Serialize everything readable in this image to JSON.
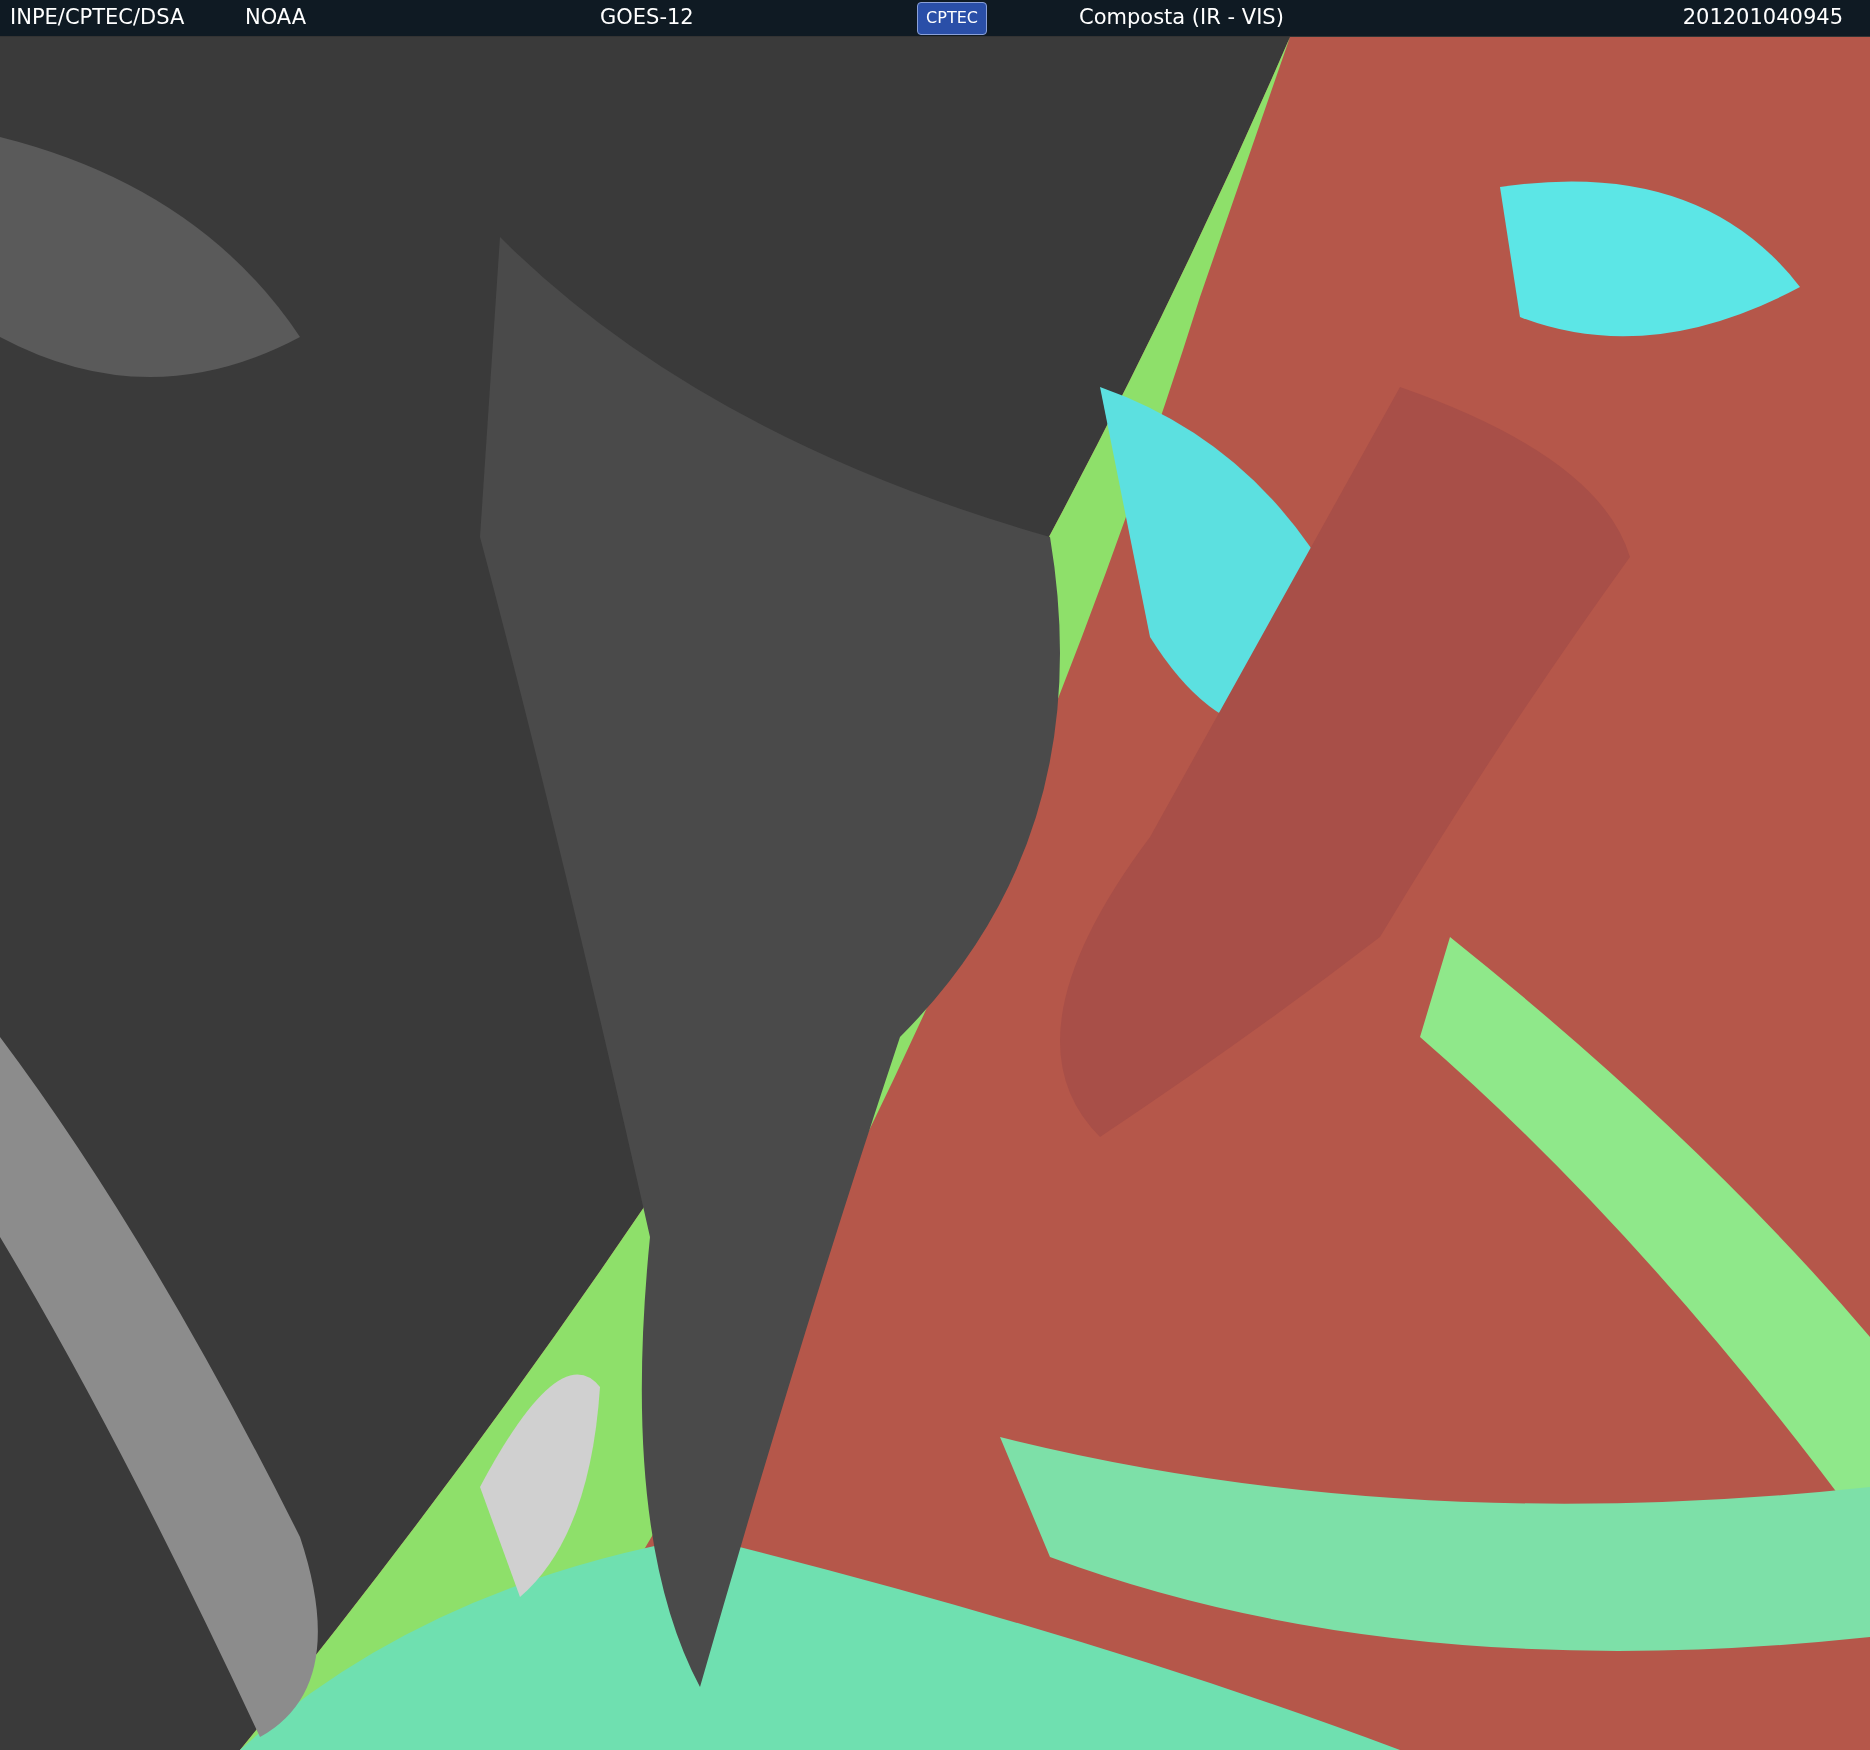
{
  "header": {
    "source": "INPE/CPTEC/DSA",
    "agency": "NOAA",
    "satellite": "GOES-12",
    "logo": "CPTEC",
    "product": "Composta (IR - VIS)",
    "timestamp": "201201040945"
  }
}
